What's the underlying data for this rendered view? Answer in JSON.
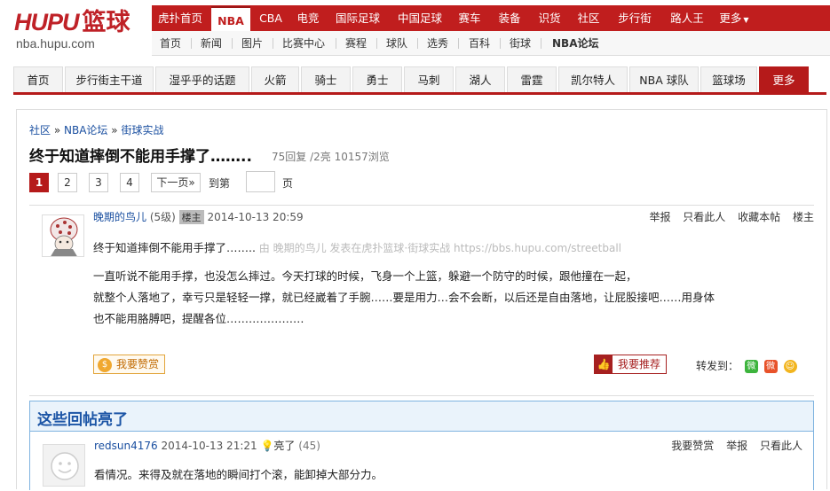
{
  "logo": {
    "brand": "HUPU",
    "brand_cn": "篮球",
    "domain": "nba.hupu.com"
  },
  "channels": [
    "虎扑首页",
    "NBA",
    "CBA",
    "电竞",
    "国际足球",
    "中国足球",
    "赛车",
    "装备",
    "识货",
    "社区",
    "步行街",
    "路人王",
    "更多"
  ],
  "subnav": [
    "首页",
    "新闻",
    "图片",
    "比赛中心",
    "赛程",
    "球队",
    "选秀",
    "百科",
    "街球",
    "NBA论坛"
  ],
  "nav2": [
    "首页",
    "步行街主干道",
    "湿乎乎的话题",
    "火箭",
    "骑士",
    "勇士",
    "马刺",
    "湖人",
    "雷霆",
    "凯尔特人",
    "NBA 球队",
    "篮球场",
    "更多"
  ],
  "breadcrumb": {
    "c1": "社区",
    "sep": "»",
    "c2": "NBA论坛",
    "c3": "街球实战"
  },
  "thread": {
    "title": "终于知道摔倒不能用手撑了……..",
    "meta": "75回复 /2亮  10157浏览"
  },
  "pager": {
    "pages": [
      "1",
      "2",
      "3",
      "4"
    ],
    "next": "下一页»",
    "goto": "到第",
    "page_unit": "页"
  },
  "post": {
    "username": "晚期的鸟儿",
    "level": "(5级)",
    "badge": "楼主",
    "time": "2014-10-13 20:59",
    "actions": [
      "举报",
      "只看此人",
      "收藏本帖",
      "楼主"
    ],
    "headline": "终于知道摔倒不能用手撑了……..",
    "source": " 由  晚期的鸟儿 发表在虎扑篮球·街球实战 https://bbs.hupu.com/streetball",
    "body": [
      "一直听说不能用手撑，也没怎么摔过。今天打球的时候，飞身一个上篮，躲避一个防守的时候，跟他撞在一起，",
      "就整个人落地了，幸亏只是轻轻一撑，就已经崴着了手腕……要是用力…会不会断，以后还是自由落地，让屁股接吧……用身体",
      "也不能用胳膊吧，提醒各位…………………"
    ],
    "zan": "我要赞赏",
    "recommend": "我要推荐",
    "share_label": "转发到："
  },
  "light": {
    "title": "这些回帖亮了",
    "reply": {
      "username": "redsun4176",
      "time": "2014-10-13 21:21",
      "lit": "亮了",
      "count": "(45)",
      "actions": [
        "我要赞赏",
        "举报",
        "只看此人"
      ],
      "body": "看情况。来得及就在落地的瞬间打个滚，能卸掉大部分力。"
    }
  }
}
